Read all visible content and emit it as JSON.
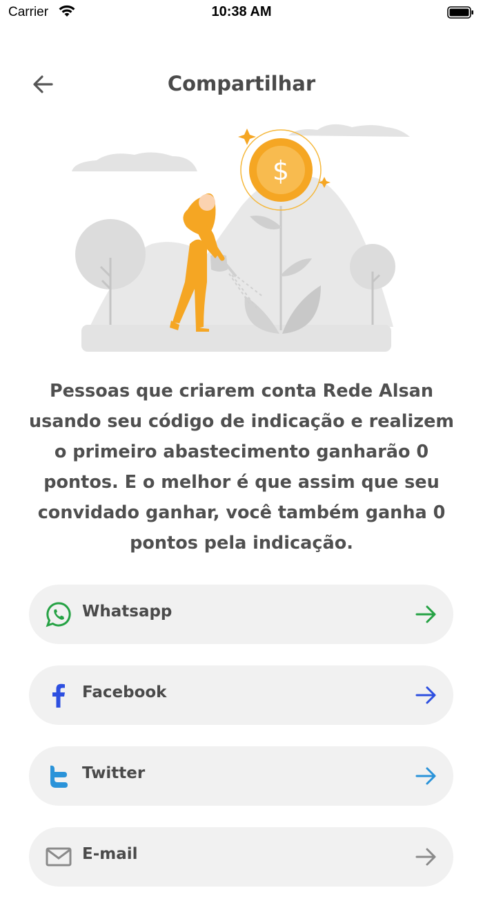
{
  "status_bar": {
    "carrier": "Carrier",
    "time": "10:38 AM"
  },
  "header": {
    "title": "Compartilhar"
  },
  "description": "Pessoas que criarem conta Rede Alsan usando seu código de indicação e realizem o primeiro abastecimento ganharão 0 pontos. E o melhor é que assim que seu convidado ganhar, você também ganha 0 pontos pela indicação.",
  "share_options": [
    {
      "label": "Whatsapp",
      "icon": "whatsapp-icon",
      "color": "#25a244"
    },
    {
      "label": "Facebook",
      "icon": "facebook-icon",
      "color": "#2d4fe0"
    },
    {
      "label": "Twitter",
      "icon": "twitter-icon",
      "color": "#2a93d9"
    },
    {
      "label": "E-mail",
      "icon": "email-icon",
      "color": "#8a8a8a"
    }
  ],
  "colors": {
    "accent": "#f5a623",
    "background": "#ffffff",
    "item_bg": "#f1f1f1"
  }
}
